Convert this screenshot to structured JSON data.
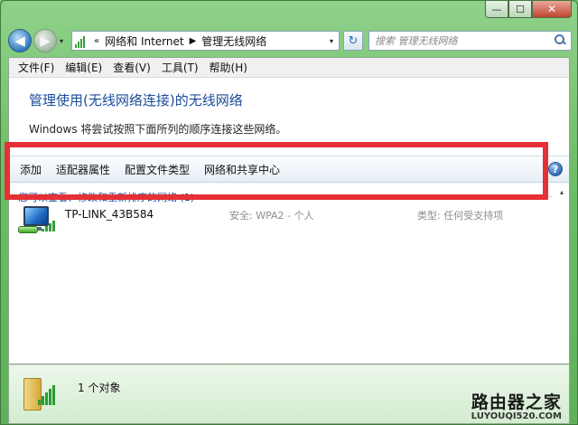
{
  "window": {
    "minimize": "—",
    "maximize": "☐",
    "close": "✕"
  },
  "nav": {
    "back": "◀",
    "forward": "▶",
    "history": "▾",
    "refresh": "↻",
    "breadcrumb": {
      "overflow": "«",
      "items": [
        "网络和 Internet",
        "管理无线网络"
      ],
      "separator": "▶",
      "dropdown": "▾"
    },
    "search": {
      "placeholder": "搜索 管理无线网络"
    }
  },
  "menu": {
    "items": [
      "文件(F)",
      "编辑(E)",
      "查看(V)",
      "工具(T)",
      "帮助(H)"
    ]
  },
  "header": {
    "title": "管理使用(无线网络连接)的无线网络",
    "description": "Windows 将尝试按照下面所列的顺序连接这些网络。"
  },
  "commands": {
    "items": [
      "添加",
      "适配器属性",
      "配置文件类型",
      "网络和共享中心"
    ],
    "help": "?"
  },
  "list": {
    "group_header": "您可以查看、修改和重新排序的网络 (1)",
    "scroll_up": "▴",
    "networks": [
      {
        "ssid": "TP-LINK_43B584",
        "security": "安全: WPA2 - 个人",
        "type": "类型: 任何受支持项"
      }
    ]
  },
  "details": {
    "count": "1 个对象"
  },
  "watermark": {
    "cn": "路由器之家",
    "en": "LUYOUQI520.COM"
  },
  "colors": {
    "highlight": "#e53036",
    "title_blue": "#1b4b9a",
    "chrome_green": "#6ebd68"
  }
}
